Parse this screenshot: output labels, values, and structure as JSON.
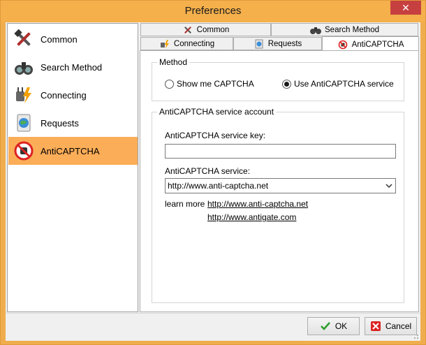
{
  "window": {
    "title": "Preferences",
    "close_label": "✕"
  },
  "sidebar": {
    "items": [
      {
        "label": "Common",
        "icon": "hammer-wrench-icon",
        "selected": false
      },
      {
        "label": "Search Method",
        "icon": "binoculars-icon",
        "selected": false
      },
      {
        "label": "Connecting",
        "icon": "plug-lightning-icon",
        "selected": false
      },
      {
        "label": "Requests",
        "icon": "document-globe-icon",
        "selected": false
      },
      {
        "label": "AntiCAPTCHA",
        "icon": "no-bot-icon",
        "selected": true
      }
    ]
  },
  "tabs": {
    "row1": [
      {
        "label": "Common",
        "icon": "hammer-wrench-icon"
      },
      {
        "label": "Search Method",
        "icon": "binoculars-icon"
      }
    ],
    "row2": [
      {
        "label": "Connecting",
        "icon": "plug-lightning-icon"
      },
      {
        "label": "Requests",
        "icon": "document-globe-icon"
      },
      {
        "label": "AntiCAPTCHA",
        "icon": "no-bot-icon",
        "active": true
      }
    ]
  },
  "method": {
    "group_label": "Method",
    "option_show": "Show me CAPTCHA",
    "option_use": "Use AntiCAPTCHA service",
    "selected": "Use AntiCAPTCHA service"
  },
  "account": {
    "group_label": "AntiCAPTCHA service account",
    "key_label": "AntiCAPTCHA service key:",
    "key_value": "",
    "service_label": "AntiCAPTCHA service:",
    "service_value": "http://www.anti-captcha.net",
    "learn_more": "learn more",
    "link1": "http://www.anti-captcha.net",
    "link2": "http://www.antigate.com"
  },
  "footer": {
    "ok_label": "OK",
    "cancel_label": "Cancel"
  },
  "colors": {
    "accent": "#f5b04c",
    "selected_item": "#fbad58",
    "close": "#c74040"
  }
}
